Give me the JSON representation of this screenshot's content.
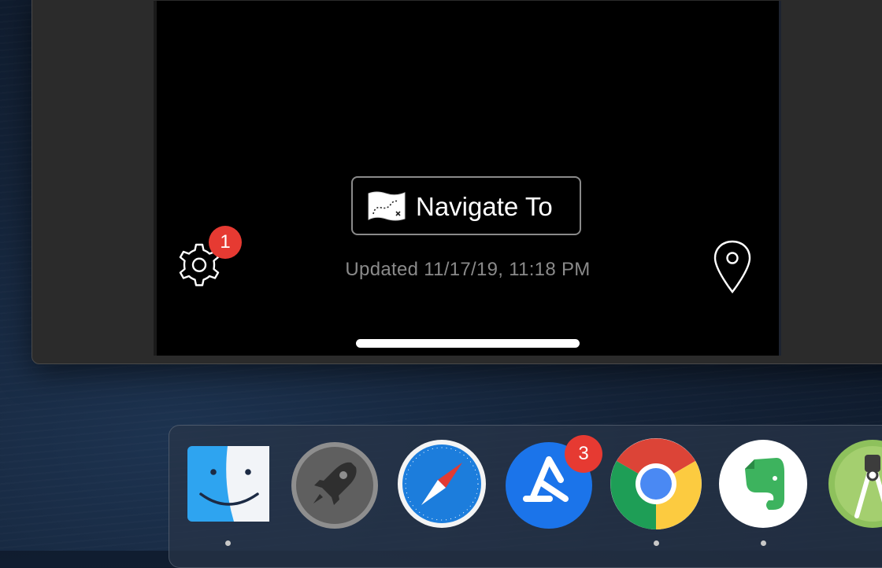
{
  "app": {
    "navigate_button_label": "Navigate To",
    "updated_text": "Updated 11/17/19, 11:18 PM",
    "settings_badge_count": "1"
  },
  "dock": {
    "items": [
      {
        "name": "Finder",
        "icon": "finder-icon",
        "running": true
      },
      {
        "name": "Launchpad",
        "icon": "rocket-icon",
        "running": false
      },
      {
        "name": "Safari",
        "icon": "compass-icon",
        "running": false
      },
      {
        "name": "App Store",
        "icon": "app-store-icon",
        "running": false,
        "badge": "3"
      },
      {
        "name": "Google Chrome",
        "icon": "chrome-icon",
        "running": true
      },
      {
        "name": "Evernote",
        "icon": "elephant-icon",
        "running": true
      },
      {
        "name": "Android Studio",
        "icon": "android-studio-icon",
        "running": false
      }
    ]
  },
  "colors": {
    "badge": "#e63a32",
    "screen_background": "#000000",
    "updated_text": "#8a8a8a"
  }
}
